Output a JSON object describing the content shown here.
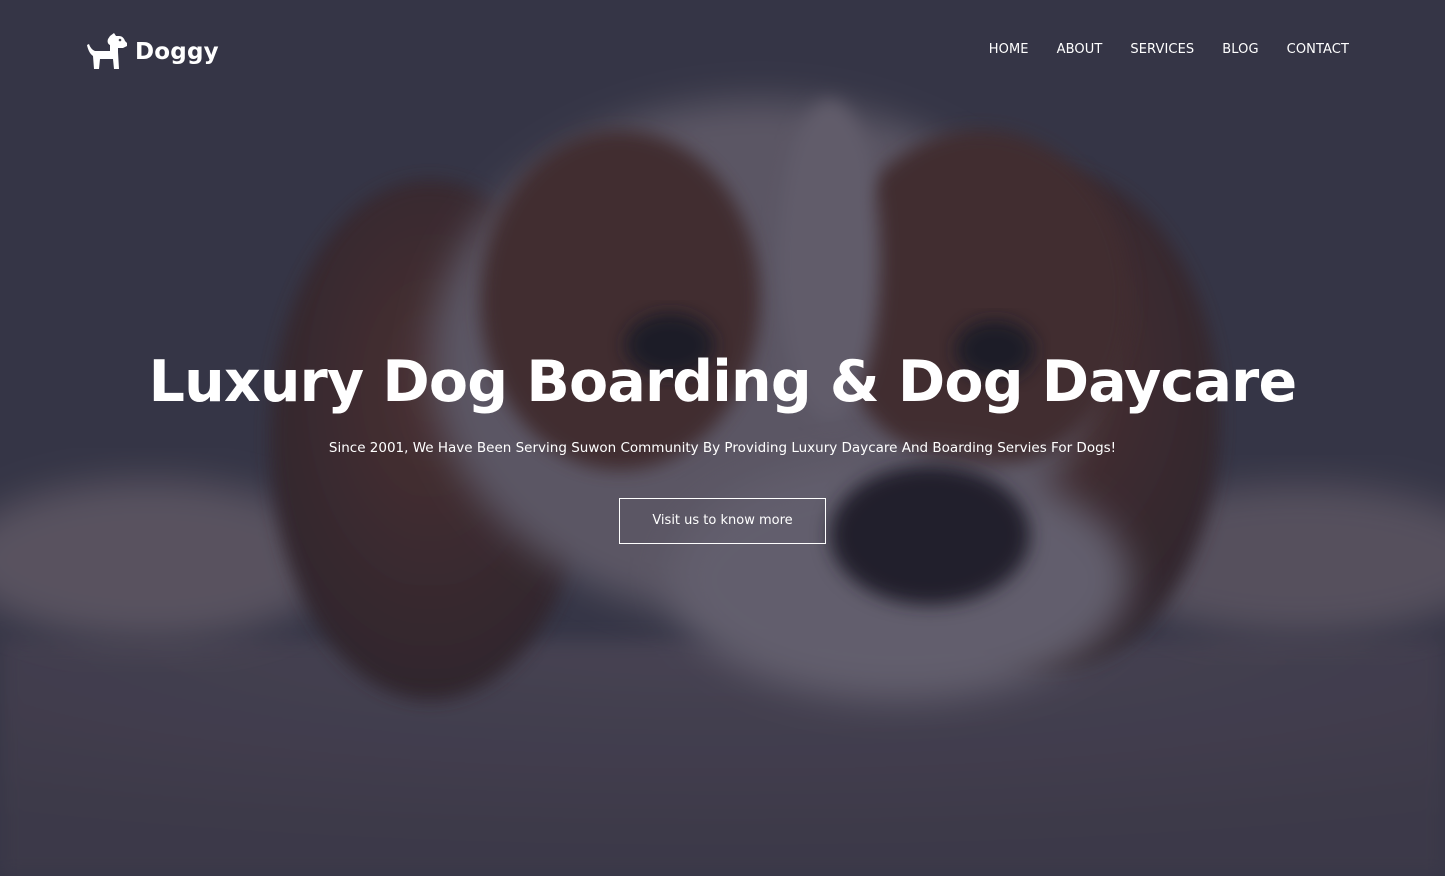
{
  "brand": {
    "name": "Doggy",
    "logo_icon": "dog-icon"
  },
  "nav": {
    "items": [
      {
        "label": "HOME"
      },
      {
        "label": "ABOUT"
      },
      {
        "label": "SERVICES"
      },
      {
        "label": "BLOG"
      },
      {
        "label": "CONTACT"
      }
    ]
  },
  "hero": {
    "headline": "Luxury Dog Boarding & Dog Daycare",
    "subtitle": "Since 2001, We Have Been Serving Suwon Community By Providing Luxury Daycare And Boarding Servies For Dogs!",
    "cta_label": "Visit us to know more"
  },
  "colors": {
    "text": "#ffffff",
    "overlay": "#1c1c2e"
  }
}
